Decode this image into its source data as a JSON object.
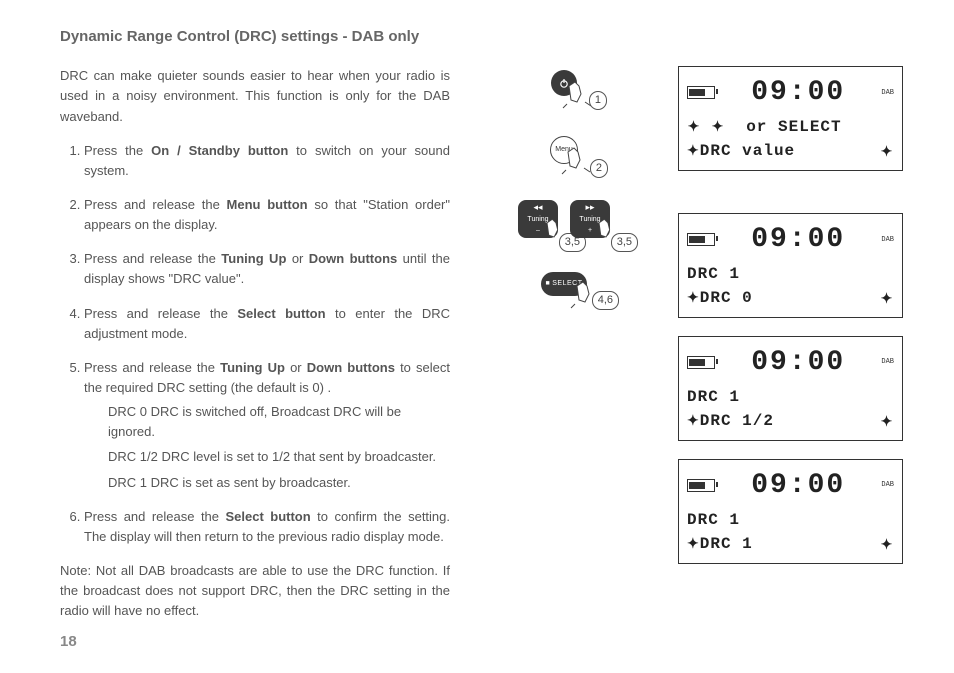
{
  "title": "Dynamic Range Control (DRC) settings - DAB only",
  "intro": "DRC can make quieter sounds easier to hear when your radio is used in a noisy environment.  This function is only for the DAB waveband.",
  "steps": {
    "s1a": "Press the ",
    "s1b": "On / Standby button",
    "s1c": " to switch on your sound system.",
    "s2a": "Press and release the ",
    "s2b": "Menu button",
    "s2c": " so that \"Station order\" appears on the display.",
    "s3a": "Press and release the ",
    "s3b": "Tuning Up",
    "s3c": " or ",
    "s3d": "Down buttons",
    "s3e": " until the display shows \"DRC value\".",
    "s4a": "Press and release the ",
    "s4b": "Select button",
    "s4c": " to enter the DRC adjustment mode.",
    "s5a": "Press and release the ",
    "s5b": "Tuning Up",
    "s5c": " or ",
    "s5d": "Down buttons",
    "s5e": " to select the required DRC setting (the default is 0) .",
    "s5_sub1": "DRC 0  DRC is switched off, Broadcast DRC will be ignored.",
    "s5_sub2": "DRC 1/2 DRC level is set to 1/2 that sent by broadcaster.",
    "s5_sub3": "DRC 1  DRC is set as sent by broadcaster.",
    "s6a": "Press and release the ",
    "s6b": "Select button",
    "s6c": " to confirm the setting. The display will then return to the previous radio display mode."
  },
  "note": "Note: Not all DAB broadcasts are able to use the DRC function. If the broadcast does not support DRC, then the DRC setting in the radio will have no effect.",
  "page_number": "18",
  "icons": {
    "power_step": "1",
    "menu_label": "Menu",
    "menu_step": "2",
    "tuning_label": "Tuning",
    "tuning_minus": "–",
    "tuning_plus": "+",
    "tuning_step": "3,5",
    "select_label": "SELECT",
    "select_step": "4,6"
  },
  "lcd": {
    "time": "09:00",
    "dab": "DAB",
    "screen1_l1": "  or SELECT",
    "screen1_l2": "DRC value",
    "screen2_l1": "DRC 1",
    "screen2_l2": "DRC 0",
    "screen3_l1": "DRC 1",
    "screen3_l2": "DRC 1/2",
    "screen4_l1": "DRC 1",
    "screen4_l2": "DRC 1"
  }
}
